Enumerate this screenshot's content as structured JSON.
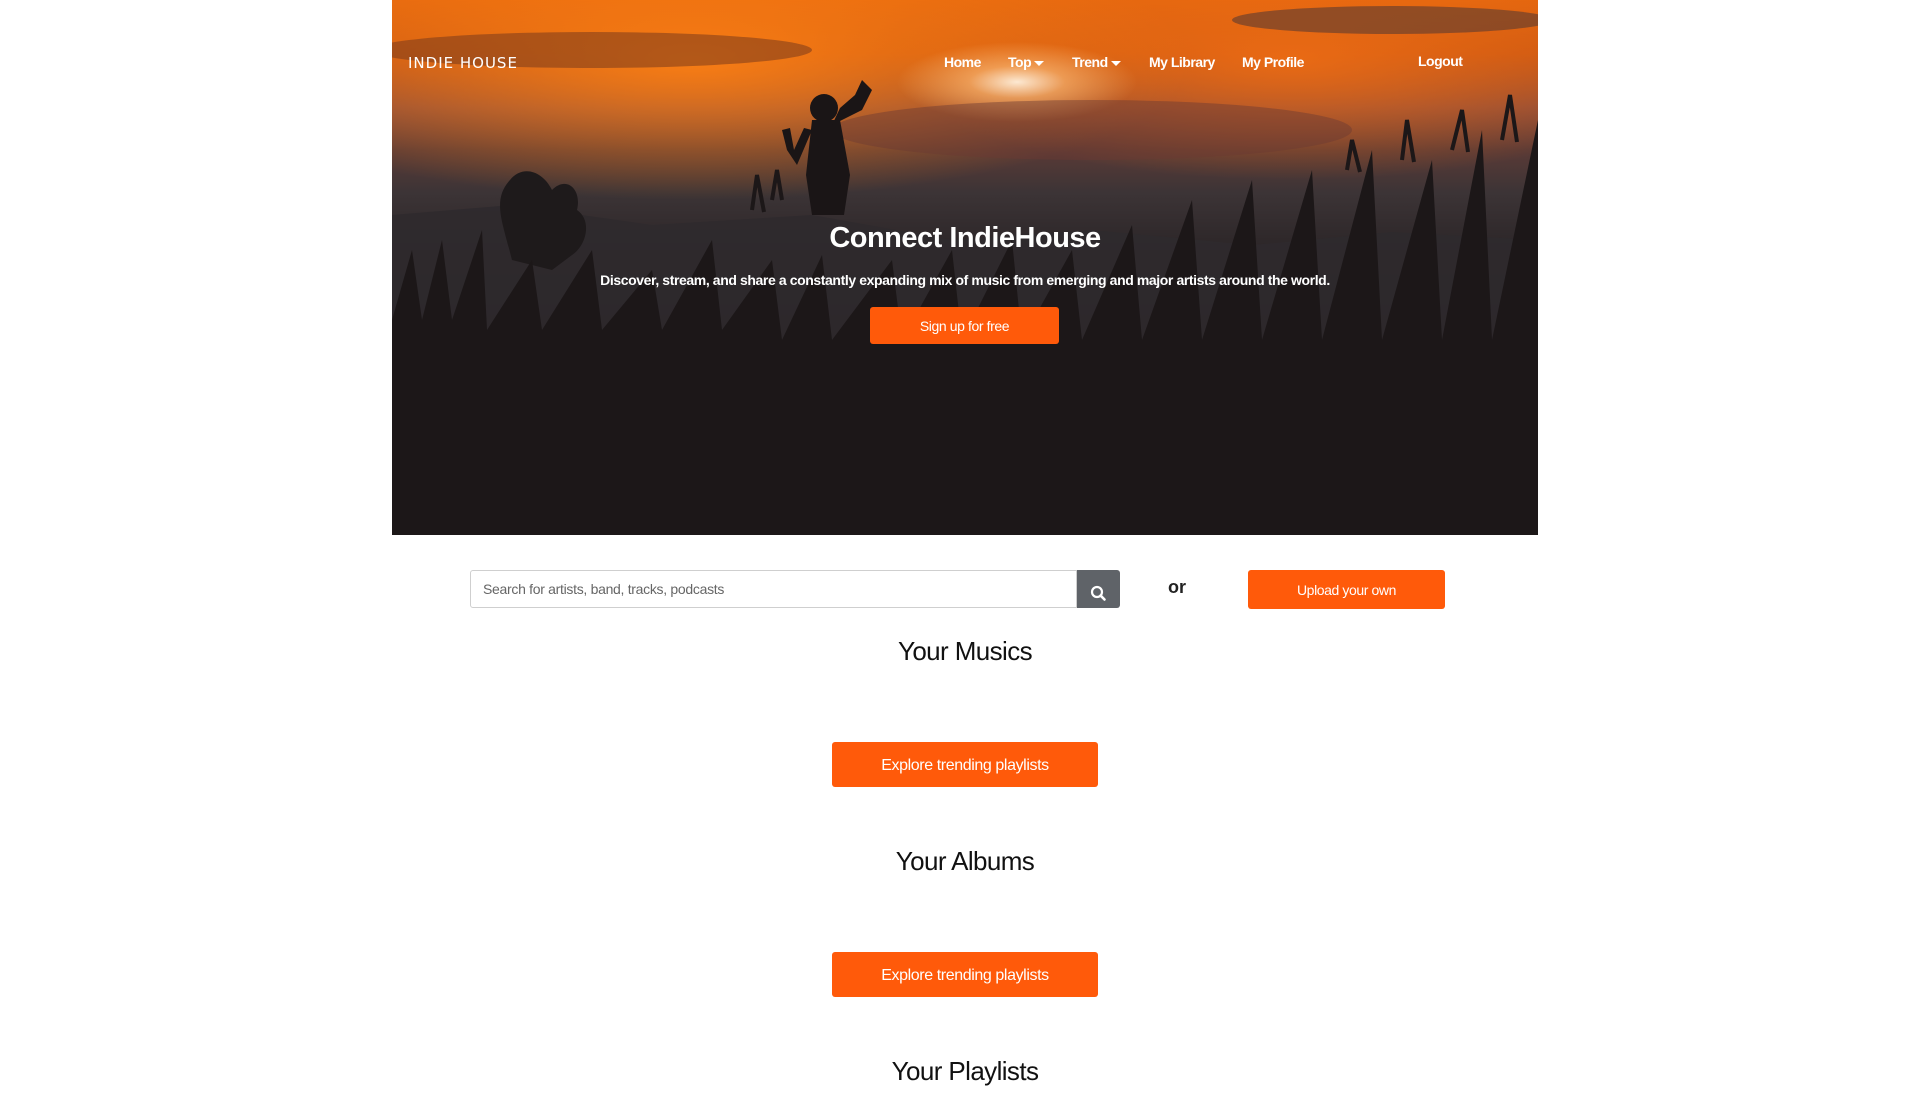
{
  "header": {
    "brand": "INDIE HOUSE",
    "nav": {
      "home": "Home",
      "top": "Top",
      "trend": "Trend",
      "library": "My Library",
      "profile": "My Profile",
      "logout": "Logout"
    }
  },
  "hero": {
    "title": "Connect IndieHouse",
    "subtitle": "Discover, stream, and share a constantly expanding mix of music from emerging and major artists around the world.",
    "cta": "Sign up for free"
  },
  "search": {
    "placeholder": "Search for artists, band, tracks, podcasts",
    "value": "",
    "icon": "search-icon"
  },
  "or_text": "or",
  "upload_label": "Upload your own",
  "sections": {
    "musics": {
      "title": "Your Musics",
      "button": "Explore trending playlists"
    },
    "albums": {
      "title": "Your Albums",
      "button": "Explore trending playlists"
    },
    "playlists": {
      "title": "Your Playlists"
    }
  },
  "colors": {
    "accent": "#ff5a0a",
    "search_button": "#5f6368"
  }
}
